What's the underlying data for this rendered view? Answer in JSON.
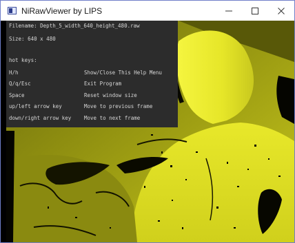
{
  "window": {
    "title": "NiRawViewer by LIPS",
    "minimize_glyph": "—",
    "maximize_glyph": "☐",
    "close_glyph": "✕"
  },
  "help": {
    "filename_line": "Filename: Depth_5_width_640_height_480.raw",
    "size_line": "Size: 640 x 480",
    "hotkeys_header": "hot keys:",
    "hotkeys": [
      {
        "key": "H/h",
        "desc": "Show/Close This Help Menu"
      },
      {
        "key": "Q/q/Esc",
        "desc": "Exit Program"
      },
      {
        "key": "Space",
        "desc": "Reset window size"
      },
      {
        "key": "up/left arrow key",
        "desc": "Move to previous frame"
      },
      {
        "key": "down/right arrow key",
        "desc": "Move to next frame"
      }
    ]
  },
  "colors": {
    "depth_bright": "#f3f32a",
    "depth_mid": "#d4d41e",
    "depth_dark": "#4e4e08",
    "help_bg": "#2c2c2c"
  }
}
